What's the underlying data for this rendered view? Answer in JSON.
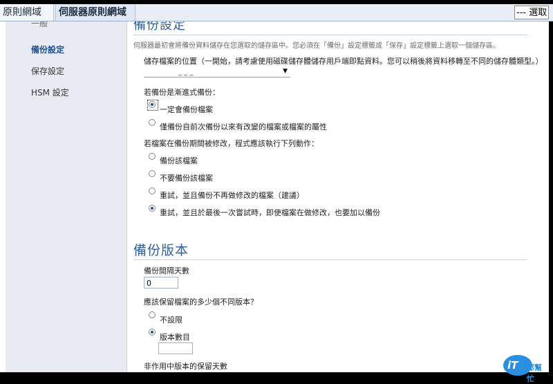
{
  "tabs": [
    {
      "label": "原則網域"
    },
    {
      "label": "伺服器原則網域"
    }
  ],
  "tab_close_glyph": "×",
  "top_select": {
    "value": "--- 選取"
  },
  "sidebar": {
    "items": [
      {
        "label": "一般"
      },
      {
        "label": "備份設定"
      },
      {
        "label": "保存設定"
      },
      {
        "label": "HSM 設定"
      }
    ]
  },
  "backup_settings": {
    "heading_partial": "備份設定",
    "description": "伺服器最初會將備份資料儲存在您選取的儲存區中。您必須在「備份」設定標籤或「保存」設定標籤上選取一個儲存區。",
    "storage_location_label": "儲存檔案的位置（一開始，請考慮使用磁碟儲存體儲存用戶端即點資料。您可以稍後將資料移轉至不同的儲存體類型。）",
    "storage_dropdown_value": "_ _ _",
    "incremental_label": "若備份是漸進式備份：",
    "incremental_options": [
      {
        "label": "一定會備份檔案",
        "selected": true
      },
      {
        "label": "僅備份自前次備份以來有改變的檔案或檔案的屬性",
        "selected": false
      }
    ],
    "modified_label": "若檔案在備份期間被修改，程式應該執行下列動作：",
    "modified_options": [
      {
        "label": "備份該檔案",
        "selected": false
      },
      {
        "label": "不要備份該檔案",
        "selected": false
      },
      {
        "label": "重試，並且備份不再做修改的檔案（建議）",
        "selected": false
      },
      {
        "label": "重試，並且於最後一次嘗試時，即使檔案在做修改，也要加以備份",
        "selected": true
      }
    ]
  },
  "backup_versions": {
    "heading": "備份版本",
    "interval_label": "備份間隔天數",
    "interval_value": "0",
    "versions_label": "應該保留檔案的多少個不同版本？",
    "versions_options": [
      {
        "label": "不設限",
        "selected": false
      },
      {
        "label": "版本數目",
        "selected": true
      }
    ],
    "versions_count_value": "",
    "inactive_label": "非作用中版本的保留天數"
  },
  "watermark": {
    "logo_text": "iT",
    "ring_text": "邦幫忙"
  },
  "colors": {
    "heading": "#2f5f9e",
    "sidebar_bg": "#e8ecf2",
    "active_sidebar": "#1a4f9c"
  }
}
